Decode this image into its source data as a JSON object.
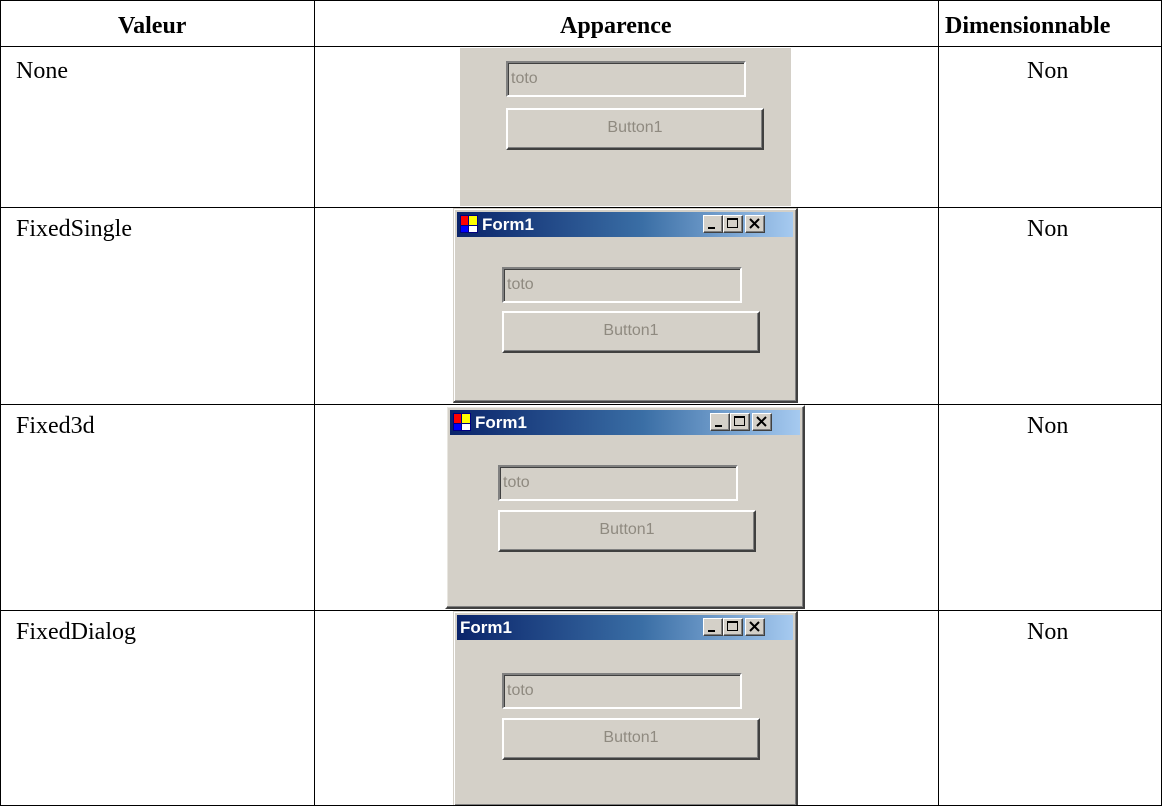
{
  "table": {
    "headers": {
      "valeur": "Valeur",
      "apparence": "Apparence",
      "dimensionnable": "Dimensionnable"
    },
    "rows": [
      {
        "valeur": "None",
        "dimensionnable": "Non",
        "form": {
          "has_titlebar": false,
          "textbox_text": "toto",
          "button_label": "Button1"
        }
      },
      {
        "valeur": "FixedSingle",
        "dimensionnable": "Non",
        "form": {
          "has_titlebar": true,
          "title": "Form1",
          "textbox_text": "toto",
          "button_label": "Button1"
        }
      },
      {
        "valeur": "Fixed3d",
        "dimensionnable": "Non",
        "form": {
          "has_titlebar": true,
          "title": "Form1",
          "textbox_text": "toto",
          "button_label": "Button1"
        }
      },
      {
        "valeur": "FixedDialog",
        "dimensionnable": "Non",
        "form": {
          "has_titlebar": true,
          "title": "Form1",
          "show_icon": false,
          "textbox_text": "toto",
          "button_label": "Button1"
        }
      }
    ]
  },
  "colors": {
    "window_face": "#d4d0c8",
    "titlebar_start": "#0a246a",
    "titlebar_end": "#a6caf0",
    "disabled_text": "#8f8a80"
  },
  "icons": {
    "app": "app-icon",
    "minimize": "minimize-icon",
    "maximize": "maximize-icon",
    "close": "close-icon"
  }
}
